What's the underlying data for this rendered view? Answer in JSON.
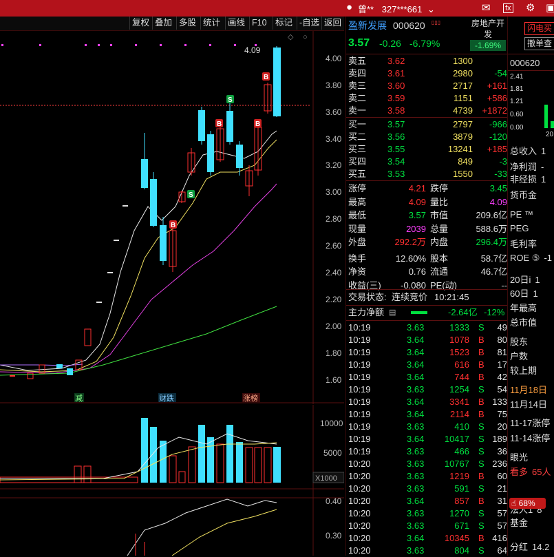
{
  "titlebar": {
    "user_name": "曾**",
    "account": "327***661"
  },
  "toolbar": [
    "复权",
    "叠加",
    "多股",
    "统计",
    "画线",
    "F10",
    "标记",
    "-自选",
    "返回"
  ],
  "chart": {
    "price_ticks": [
      "4.00",
      "3.80",
      "3.60",
      "3.40",
      "3.20",
      "3.00",
      "2.80",
      "2.60",
      "2.40",
      "2.20",
      "2.00",
      "1.80",
      "1.60"
    ],
    "high_label": "4.09",
    "event_tags": [
      "减",
      "财跌",
      "涨榜"
    ],
    "volume_ticks": [
      "10000",
      "5000"
    ],
    "volume_unit": "X1000",
    "indicator_ticks": [
      "0.40",
      "0.30"
    ],
    "signal_buy": "B",
    "signal_sell": "S"
  },
  "header": {
    "name": "盈新发展",
    "code": "000620",
    "sector": "房地产开发",
    "sector_change": "-1.69%",
    "price": "3.57",
    "change": "-0.26",
    "pct": "-6.79%"
  },
  "asks": [
    {
      "label": "卖五",
      "price": "3.62",
      "vol": "1300",
      "delta": ""
    },
    {
      "label": "卖四",
      "price": "3.61",
      "vol": "2980",
      "delta": "-54"
    },
    {
      "label": "卖三",
      "price": "3.60",
      "vol": "2717",
      "delta": "+161"
    },
    {
      "label": "卖二",
      "price": "3.59",
      "vol": "1151",
      "delta": "+586"
    },
    {
      "label": "卖一",
      "price": "3.58",
      "vol": "4739",
      "delta": "+1872"
    }
  ],
  "bids": [
    {
      "label": "买一",
      "price": "3.57",
      "vol": "2797",
      "delta": "-966"
    },
    {
      "label": "买二",
      "price": "3.56",
      "vol": "3879",
      "delta": "-120"
    },
    {
      "label": "买三",
      "price": "3.55",
      "vol": "13241",
      "delta": "+185"
    },
    {
      "label": "买四",
      "price": "3.54",
      "vol": "849",
      "delta": "-3"
    },
    {
      "label": "买五",
      "price": "3.53",
      "vol": "1550",
      "delta": "-33"
    }
  ],
  "stats": [
    {
      "l1": "涨停",
      "v1": "4.21",
      "l2": "跌停",
      "v2": "3.45"
    },
    {
      "l1": "最高",
      "v1": "4.09",
      "l2": "量比",
      "v2": "4.09"
    },
    {
      "l1": "最低",
      "v1": "3.57",
      "l2": "市值",
      "v2": "209.6亿"
    },
    {
      "l1": "现量",
      "v1": "2039",
      "l2": "总量",
      "v2": "588.6万"
    },
    {
      "l1": "外盘",
      "v1": "292.2万",
      "l2": "内盘",
      "v2": "296.4万"
    },
    {
      "l1": "换手",
      "v1": "12.60%",
      "l2": "股本",
      "v2": "58.7亿"
    },
    {
      "l1": "净资",
      "v1": "0.76",
      "l2": "流通",
      "v2": "46.7亿"
    },
    {
      "l1": "收益(三)",
      "v1": "-0.080",
      "l2": "PE(动)",
      "v2": "--"
    }
  ],
  "trade_status": {
    "label": "交易状态:",
    "value": "连续竞价",
    "time": "10:21:45"
  },
  "main_flow": {
    "label": "主力净额",
    "value": "-2.64亿",
    "pct": "-12%"
  },
  "ticks": [
    {
      "t": "10:19",
      "p": "3.63",
      "v": "1333",
      "d": "S",
      "n": "49"
    },
    {
      "t": "10:19",
      "p": "3.64",
      "v": "1078",
      "d": "B",
      "n": "80"
    },
    {
      "t": "10:19",
      "p": "3.64",
      "v": "1523",
      "d": "B",
      "n": "81"
    },
    {
      "t": "10:19",
      "p": "3.64",
      "v": "616",
      "d": "B",
      "n": "17"
    },
    {
      "t": "10:19",
      "p": "3.64",
      "v": "744",
      "d": "B",
      "n": "42"
    },
    {
      "t": "10:19",
      "p": "3.63",
      "v": "1254",
      "d": "S",
      "n": "54"
    },
    {
      "t": "10:19",
      "p": "3.64",
      "v": "3341",
      "d": "B",
      "n": "133"
    },
    {
      "t": "10:19",
      "p": "3.64",
      "v": "2114",
      "d": "B",
      "n": "75"
    },
    {
      "t": "10:19",
      "p": "3.63",
      "v": "410",
      "d": "S",
      "n": "20"
    },
    {
      "t": "10:19",
      "p": "3.64",
      "v": "10417",
      "d": "S",
      "n": "189"
    },
    {
      "t": "10:19",
      "p": "3.63",
      "v": "466",
      "d": "S",
      "n": "36"
    },
    {
      "t": "10:20",
      "p": "3.63",
      "v": "10767",
      "d": "S",
      "n": "236"
    },
    {
      "t": "10:20",
      "p": "3.63",
      "v": "1219",
      "d": "B",
      "n": "60"
    },
    {
      "t": "10:20",
      "p": "3.63",
      "v": "591",
      "d": "S",
      "n": "21"
    },
    {
      "t": "10:20",
      "p": "3.64",
      "v": "857",
      "d": "B",
      "n": "31"
    },
    {
      "t": "10:20",
      "p": "3.63",
      "v": "1270",
      "d": "S",
      "n": "57"
    },
    {
      "t": "10:20",
      "p": "3.63",
      "v": "671",
      "d": "S",
      "n": "57"
    },
    {
      "t": "10:20",
      "p": "3.64",
      "v": "10345",
      "d": "B",
      "n": "416"
    },
    {
      "t": "10:20",
      "p": "3.63",
      "v": "804",
      "d": "S",
      "n": "64"
    }
  ],
  "far": {
    "btn1": "闪电买",
    "btn2": "撤单查",
    "code": "000620",
    "mini_ticks": [
      "2.41",
      "1.81",
      "1.21",
      "0.60",
      "0.00"
    ],
    "mini_axis": "20",
    "labels": [
      "总收入",
      "净利润",
      "非经损",
      "货币金",
      "PE ™",
      "PEG",
      "毛利率",
      "ROE ⑤",
      "20日i",
      "60日",
      "年最高",
      "总市值",
      "股东",
      "户数",
      "较上期",
      "11月18日",
      "11月14日",
      "11-17涨停",
      "11-14涨停",
      "眼光",
      "看多",
      "法人1",
      "基金",
      "分红"
    ],
    "values": [
      "1",
      "-",
      "1",
      "",
      "",
      "",
      "",
      "-1",
      "1",
      "1",
      "",
      "",
      "",
      "",
      "",
      "",
      "",
      "",
      "",
      "",
      "65人",
      "8",
      "",
      "14.2"
    ],
    "pct": "68%"
  }
}
